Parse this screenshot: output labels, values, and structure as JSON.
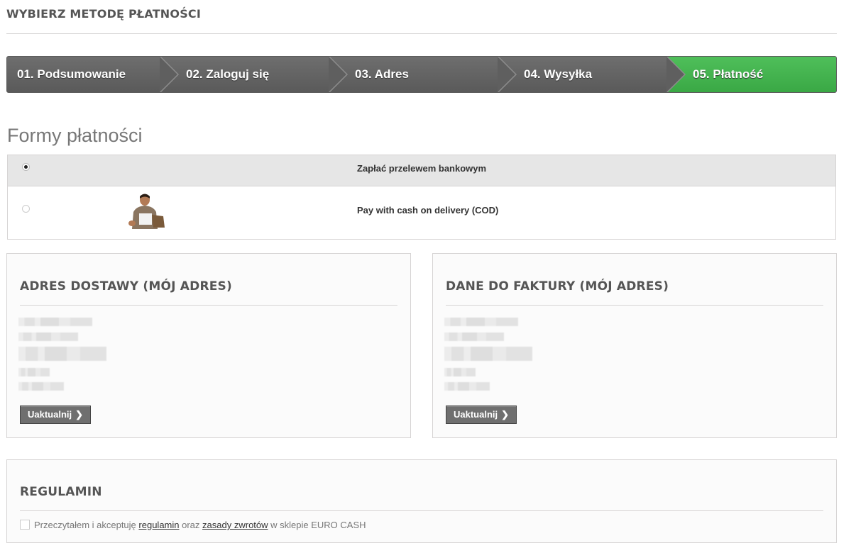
{
  "page": {
    "heading": "WYBIERZ METODĘ PŁATNOŚCI"
  },
  "steps": [
    {
      "label": "01. Podsumowanie",
      "state": "done"
    },
    {
      "label": "02. Zaloguj się",
      "state": "done"
    },
    {
      "label": "03. Adres",
      "state": "done"
    },
    {
      "label": "04. Wysyłka",
      "state": "done"
    },
    {
      "label": "05. Płatność",
      "state": "current"
    }
  ],
  "payment": {
    "title": "Formy płatności",
    "options": [
      {
        "label": "Zapłać przelewem bankowym",
        "selected": true,
        "icon": ""
      },
      {
        "label": "Pay with cash on delivery (COD)",
        "selected": false,
        "icon": "cod-person-icon"
      }
    ]
  },
  "delivery": {
    "title": "ADRES DOSTAWY (MÓJ ADRES)",
    "button": "Uaktualnij"
  },
  "invoice": {
    "title": "DANE DO FAKTURY (MÓJ ADRES)",
    "button": "Uaktualnij"
  },
  "terms": {
    "title": "REGULAMIN",
    "text_before": "Przeczytałem i akceptuję",
    "link1": "regulamin",
    "text_mid": "oraz",
    "link2": "zasady zwrotów",
    "text_after": "w sklepie EURO CASH",
    "checked": false
  },
  "colors": {
    "step": "#666666",
    "current_step": "#46b450"
  }
}
